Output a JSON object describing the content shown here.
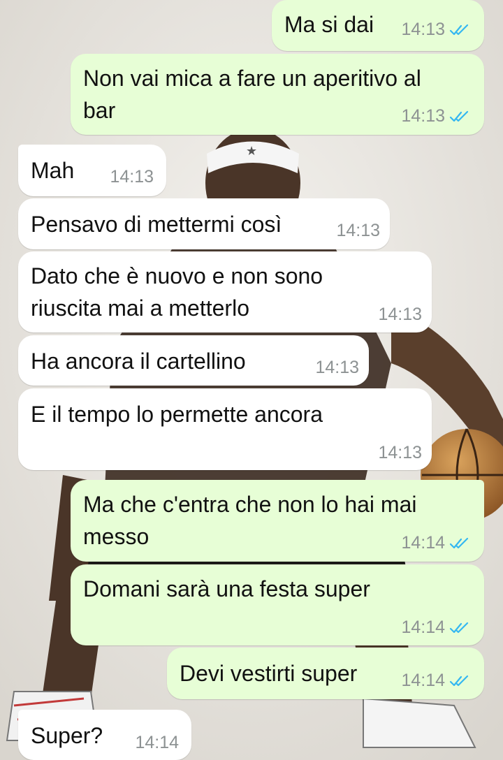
{
  "colors": {
    "incoming_bubble": "#ffffff",
    "outgoing_bubble": "#e7fed6",
    "read_ticks": "#34b7f1",
    "timestamp": "#8d9293"
  },
  "messages": [
    {
      "direction": "out",
      "text": "Ma si dai",
      "time": "14:13",
      "status": "read"
    },
    {
      "direction": "out",
      "text": "Non vai mica a fare un aperitivo al\nbar",
      "time": "14:13",
      "status": "read"
    },
    {
      "direction": "in",
      "text": "Mah",
      "time": "14:13"
    },
    {
      "direction": "in",
      "text": "Pensavo di mettermi così",
      "time": "14:13"
    },
    {
      "direction": "in",
      "text": "Dato che è nuovo e non sono\nriuscita mai a metterlo",
      "time": "14:13"
    },
    {
      "direction": "in",
      "text": "Ha ancora il cartellino",
      "time": "14:13"
    },
    {
      "direction": "in",
      "text": "E il tempo lo permette ancora",
      "time": "14:13"
    },
    {
      "direction": "out",
      "text": "Ma che c'entra che non lo hai mai\nmesso",
      "time": "14:14",
      "status": "read"
    },
    {
      "direction": "out",
      "text": "Domani sarà una festa super",
      "time": "14:14",
      "status": "read"
    },
    {
      "direction": "out",
      "text": "Devi vestirti super",
      "time": "14:14",
      "status": "read"
    },
    {
      "direction": "in",
      "text": "Super?",
      "time": "14:14"
    }
  ]
}
